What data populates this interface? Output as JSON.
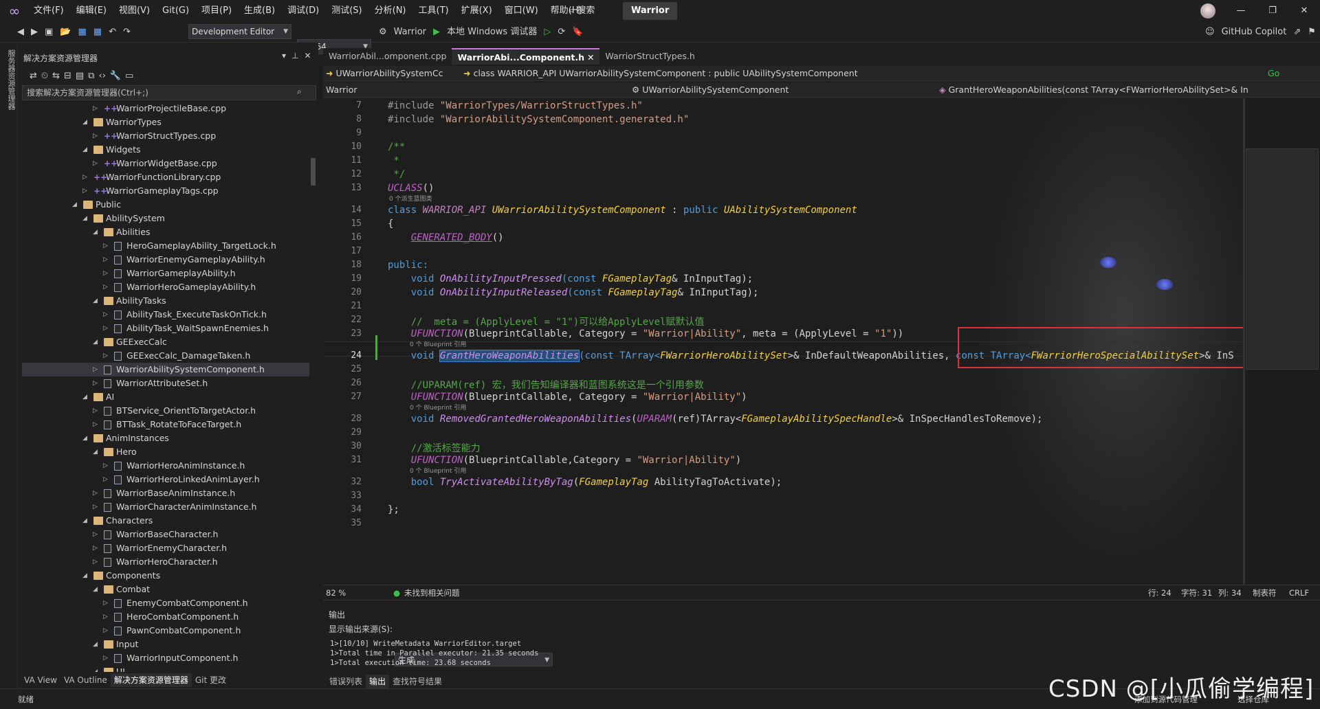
{
  "menubar": {
    "items": [
      "文件(F)",
      "编辑(E)",
      "视图(V)",
      "Git(G)",
      "项目(P)",
      "生成(B)",
      "调试(D)",
      "测试(S)",
      "分析(N)",
      "工具(T)",
      "扩展(X)",
      "窗口(W)",
      "帮助(H)"
    ],
    "search": "搜索",
    "solution": "Warrior"
  },
  "toolbar": {
    "config": "Development Editor",
    "platform": "Win64",
    "startup": "Warrior",
    "debugger": "本地 Windows 调试器",
    "copilot": "GitHub Copilot"
  },
  "left_strip": "服务器资源管理器",
  "solution_explorer": {
    "title": "解决方案资源管理器",
    "search_placeholder": "搜索解决方案资源管理器(Ctrl+;)",
    "items": [
      {
        "label": "WarriorProjectileBase.cpp",
        "indent": 6,
        "type": "cpp",
        "tw": "▷"
      },
      {
        "label": "WarriorTypes",
        "indent": 5,
        "type": "folder",
        "tw": "◢"
      },
      {
        "label": "WarriorStructTypes.cpp",
        "indent": 6,
        "type": "cpp",
        "tw": "▷"
      },
      {
        "label": "Widgets",
        "indent": 5,
        "type": "folder",
        "tw": "◢"
      },
      {
        "label": "WarriorWidgetBase.cpp",
        "indent": 6,
        "type": "cpp",
        "tw": "▷"
      },
      {
        "label": "WarriorFunctionLibrary.cpp",
        "indent": 5,
        "type": "cpp",
        "tw": "▷"
      },
      {
        "label": "WarriorGameplayTags.cpp",
        "indent": 5,
        "type": "cpp",
        "tw": "▷"
      },
      {
        "label": "Public",
        "indent": 4,
        "type": "folder",
        "tw": "◢"
      },
      {
        "label": "AbilitySystem",
        "indent": 5,
        "type": "folder",
        "tw": "◢"
      },
      {
        "label": "Abilities",
        "indent": 6,
        "type": "folder",
        "tw": "◢"
      },
      {
        "label": "HeroGameplayAbility_TargetLock.h",
        "indent": 7,
        "type": "h",
        "tw": "▷"
      },
      {
        "label": "WarriorEnemyGameplayAbility.h",
        "indent": 7,
        "type": "h",
        "tw": "▷"
      },
      {
        "label": "WarriorGameplayAbility.h",
        "indent": 7,
        "type": "h",
        "tw": "▷"
      },
      {
        "label": "WarriorHeroGameplayAbility.h",
        "indent": 7,
        "type": "h",
        "tw": "▷"
      },
      {
        "label": "AbilityTasks",
        "indent": 6,
        "type": "folder",
        "tw": "◢"
      },
      {
        "label": "AbilityTask_ExecuteTaskOnTick.h",
        "indent": 7,
        "type": "h",
        "tw": "▷"
      },
      {
        "label": "AbilityTask_WaitSpawnEnemies.h",
        "indent": 7,
        "type": "h",
        "tw": "▷"
      },
      {
        "label": "GEExecCalc",
        "indent": 6,
        "type": "folder",
        "tw": "◢"
      },
      {
        "label": "GEExecCalc_DamageTaken.h",
        "indent": 7,
        "type": "h",
        "tw": "▷"
      },
      {
        "label": "WarriorAbilitySystemComponent.h",
        "indent": 6,
        "type": "h",
        "tw": "▷",
        "selected": true
      },
      {
        "label": "WarriorAttributeSet.h",
        "indent": 6,
        "type": "h",
        "tw": "▷"
      },
      {
        "label": "AI",
        "indent": 5,
        "type": "folder",
        "tw": "◢"
      },
      {
        "label": "BTService_OrientToTargetActor.h",
        "indent": 6,
        "type": "h",
        "tw": "▷"
      },
      {
        "label": "BTTask_RotateToFaceTarget.h",
        "indent": 6,
        "type": "h",
        "tw": "▷"
      },
      {
        "label": "AnimInstances",
        "indent": 5,
        "type": "folder",
        "tw": "◢"
      },
      {
        "label": "Hero",
        "indent": 6,
        "type": "folder",
        "tw": "◢"
      },
      {
        "label": "WarriorHeroAnimInstance.h",
        "indent": 7,
        "type": "h",
        "tw": "▷"
      },
      {
        "label": "WarriorHeroLinkedAnimLayer.h",
        "indent": 7,
        "type": "h",
        "tw": "▷"
      },
      {
        "label": "WarriorBaseAnimInstance.h",
        "indent": 6,
        "type": "h",
        "tw": "▷"
      },
      {
        "label": "WarriorCharacterAnimInstance.h",
        "indent": 6,
        "type": "h",
        "tw": "▷"
      },
      {
        "label": "Characters",
        "indent": 5,
        "type": "folder",
        "tw": "◢"
      },
      {
        "label": "WarriorBaseCharacter.h",
        "indent": 6,
        "type": "h",
        "tw": "▷"
      },
      {
        "label": "WarriorEnemyCharacter.h",
        "indent": 6,
        "type": "h",
        "tw": "▷"
      },
      {
        "label": "WarriorHeroCharacter.h",
        "indent": 6,
        "type": "h",
        "tw": "▷"
      },
      {
        "label": "Components",
        "indent": 5,
        "type": "folder",
        "tw": "◢"
      },
      {
        "label": "Combat",
        "indent": 6,
        "type": "folder",
        "tw": "◢"
      },
      {
        "label": "EnemyCombatComponent.h",
        "indent": 7,
        "type": "h",
        "tw": "▷"
      },
      {
        "label": "HeroCombatComponent.h",
        "indent": 7,
        "type": "h",
        "tw": "▷"
      },
      {
        "label": "PawnCombatComponent.h",
        "indent": 7,
        "type": "h",
        "tw": "▷"
      },
      {
        "label": "Input",
        "indent": 6,
        "type": "folder",
        "tw": "◢"
      },
      {
        "label": "WarriorInputComponent.h",
        "indent": 7,
        "type": "h",
        "tw": "▷"
      },
      {
        "label": "UI",
        "indent": 6,
        "type": "folder",
        "tw": "◢"
      }
    ],
    "bottom_tabs": [
      "VA View",
      "VA Outline",
      "解决方案资源管理器",
      "Git 更改"
    ]
  },
  "doc_tabs": [
    "WarriorAbil...omponent.cpp",
    "WarriorAbi...Component.h",
    "WarriorStructTypes.h"
  ],
  "nav": {
    "project_combo": "UWarriorAbilitySystemCc",
    "class_sig": "class WARRIOR_API UWarriorAbilitySystemComponent : public UAbilitySystemComponent",
    "scope": "Warrior",
    "class": "UWarriorAbilitySystemComponent",
    "member": "GrantHeroWeaponAbilities(const TArray<FWarriorHeroAbilitySet>& In",
    "go": "Go"
  },
  "line_numbers": [
    "7",
    "8",
    "9",
    "10",
    "11",
    "12",
    "13",
    "14",
    "15",
    "16",
    "17",
    "18",
    "19",
    "20",
    "21",
    "22",
    "23",
    "24",
    "25",
    "26",
    "27",
    "28",
    "29",
    "30",
    "31",
    "32",
    "33",
    "34",
    "35"
  ],
  "hints": [
    "0 个派生蓝图类",
    "0 个 Blueprint 引用",
    "0 个 Blueprint 引用",
    "0 个 Blueprint 引用"
  ],
  "code": {
    "l7a": "#include ",
    "l7b": "\"WarriorTypes/WarriorStructTypes.h\"",
    "l8a": "#include ",
    "l8b": "\"WarriorAbilitySystemComponent.generated.h\"",
    "l10": "/**",
    "l11": " *",
    "l12": " */",
    "l13a": "UCLASS",
    "l13b": "()",
    "l14a": "class ",
    "l14b": "WARRIOR_API ",
    "l14c": "UWarriorAbilitySystemComponent",
    "l14d": " : ",
    "l14e": "public ",
    "l14f": "UAbilitySystemComponent",
    "l15": "{",
    "l16a": "    ",
    "l16b": "GENERATED_BODY",
    "l16c": "()",
    "l18": "public:",
    "l19a": "    void ",
    "l19b": "OnAbilityInputPressed",
    "l19c": "(const ",
    "l19d": "FGameplayTag",
    "l19e": "& InInputTag);",
    "l20a": "    void ",
    "l20b": "OnAbilityInputReleased",
    "l20c": "(const ",
    "l20d": "FGameplayTag",
    "l20e": "& InInputTag);",
    "l22": "    //  meta = (ApplyLevel = \"1\")可以给ApplyLevel赋默认值",
    "l23a": "    ",
    "l23b": "UFUNCTION",
    "l23c": "(BlueprintCallable, Category = ",
    "l23d": "\"Warrior|Ability\"",
    "l23e": ", meta = (ApplyLevel = ",
    "l23f": "\"1\"",
    "l23g": "))",
    "l24a": "    void ",
    "l24b": "GrantHeroWeaponAbilities",
    "l24c": "(const TArray<",
    "l24d": "FWarriorHeroAbilitySet",
    "l24e": ">& InDefaultWeaponAbilities, ",
    "l24f": "const TArray<",
    "l24g": "FWarriorHeroSpecialAbilitySet",
    "l24h": ">& InS",
    "l26": "    //UPARAM(ref) 宏，我们告知编译器和蓝图系统这是一个引用参数",
    "l27a": "    ",
    "l27b": "UFUNCTION",
    "l27c": "(BlueprintCallable, Category = ",
    "l27d": "\"Warrior|Ability\"",
    "l27e": ")",
    "l28a": "    void ",
    "l28b": "RemovedGrantedHeroWeaponAbilities",
    "l28c": "(",
    "l28d": "UPARAM",
    "l28e": "(ref)TArray<",
    "l28f": "FGameplayAbilitySpecHandle",
    "l28g": ">& InSpecHandlesToRemove);",
    "l30": "    //激活标签能力",
    "l31a": "    ",
    "l31b": "UFUNCTION",
    "l31c": "(BlueprintCallable,Category = ",
    "l31d": "\"Warrior|Ability\"",
    "l31e": ")",
    "l32a": "    bool ",
    "l32b": "TryActivateAbilityByTag",
    "l32c": "(",
    "l32d": "FGameplayTag",
    "l32e": " AbilityTagToActivate);",
    "l34": "};"
  },
  "editor_status": {
    "zoom": "82 %",
    "issues": "未找到相关问题",
    "line": "行: 24",
    "char": "字符: 31",
    "col": "列: 34",
    "tabs": "制表符",
    "eol": "CRLF"
  },
  "output": {
    "title": "输出",
    "source_label": "显示输出来源(S):",
    "source_value": "生成",
    "lines": [
      "1>[10/10] WriteMetadata WarriorEditor.target",
      "1>Total time in Parallel executor: 21.35 seconds",
      "1>Total execution time: 23.68 seconds"
    ],
    "tabs": [
      "错误列表",
      "输出",
      "查找符号结果"
    ]
  },
  "statusbar": {
    "ready": "就绪",
    "add_source": "添加到源代码管理",
    "select_repo": "选择仓库"
  },
  "watermark": "CSDN @[小瓜偷学编程]",
  "colors": {
    "accent": "#c678dd",
    "highlight_box": "#e0303a",
    "selection": "#264f78"
  }
}
